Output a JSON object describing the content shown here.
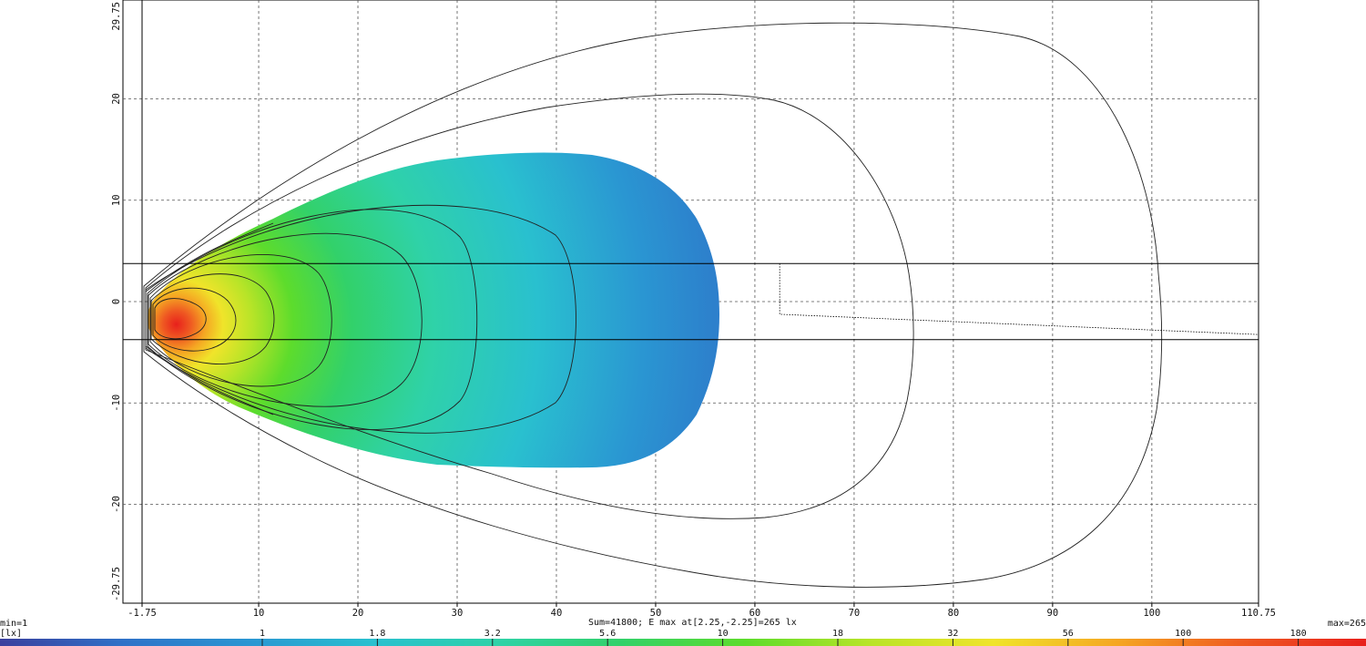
{
  "chart_data": {
    "type": "heatmap",
    "title": "",
    "xlabel": "",
    "ylabel": "",
    "xlim": [
      -1.75,
      110.75
    ],
    "ylim": [
      -29.75,
      29.75
    ],
    "x_ticks": [
      "-1.75",
      "10",
      "20",
      "30",
      "40",
      "50",
      "60",
      "70",
      "80",
      "90",
      "100",
      "110.75"
    ],
    "y_ticks": [
      "29.75",
      "20",
      "10",
      "0",
      "-10",
      "-20",
      "-29.75"
    ],
    "x_tick_values": [
      -1.75,
      10,
      20,
      30,
      40,
      50,
      60,
      70,
      80,
      90,
      100,
      110.75
    ],
    "y_tick_values": [
      29.75,
      20,
      10,
      0,
      -10,
      -20,
      -29.75
    ],
    "grid": true,
    "summary": "Sum=41800; E max at[2.25,-2.25]=265 lx",
    "max_location": [
      2.25,
      -2.25
    ],
    "max_value": 265,
    "reference_lines": {
      "horizontal_y": [
        3.75,
        -3.75
      ],
      "cutoff_line": [
        [
          62.5,
          3.75
        ],
        [
          62.5,
          -1.25
        ],
        [
          110.75,
          -3.25
        ]
      ]
    },
    "contour_extents": [
      {
        "level": 1,
        "x_max": 57.0,
        "y_half": 15.5
      },
      {
        "level": 0.3,
        "x_max": 76.5,
        "y_half": 21.5
      },
      {
        "level": 0.1,
        "x_max": 101.5,
        "y_half": 28.0
      }
    ],
    "legend": {
      "min_label": "min=1",
      "max_label": "max=265",
      "unit": "[lx]",
      "ticks": [
        "1",
        "1.8",
        "3.2",
        "5.6",
        "10",
        "18",
        "32",
        "56",
        "100",
        "180"
      ],
      "colors": [
        "#3a3f9e",
        "#2f72c8",
        "#2a96d2",
        "#29c0cf",
        "#2fd2a8",
        "#32d16a",
        "#5ddc2c",
        "#b8e428",
        "#f0e42a",
        "#f5a623",
        "#ef5a22",
        "#e8201c"
      ]
    }
  }
}
